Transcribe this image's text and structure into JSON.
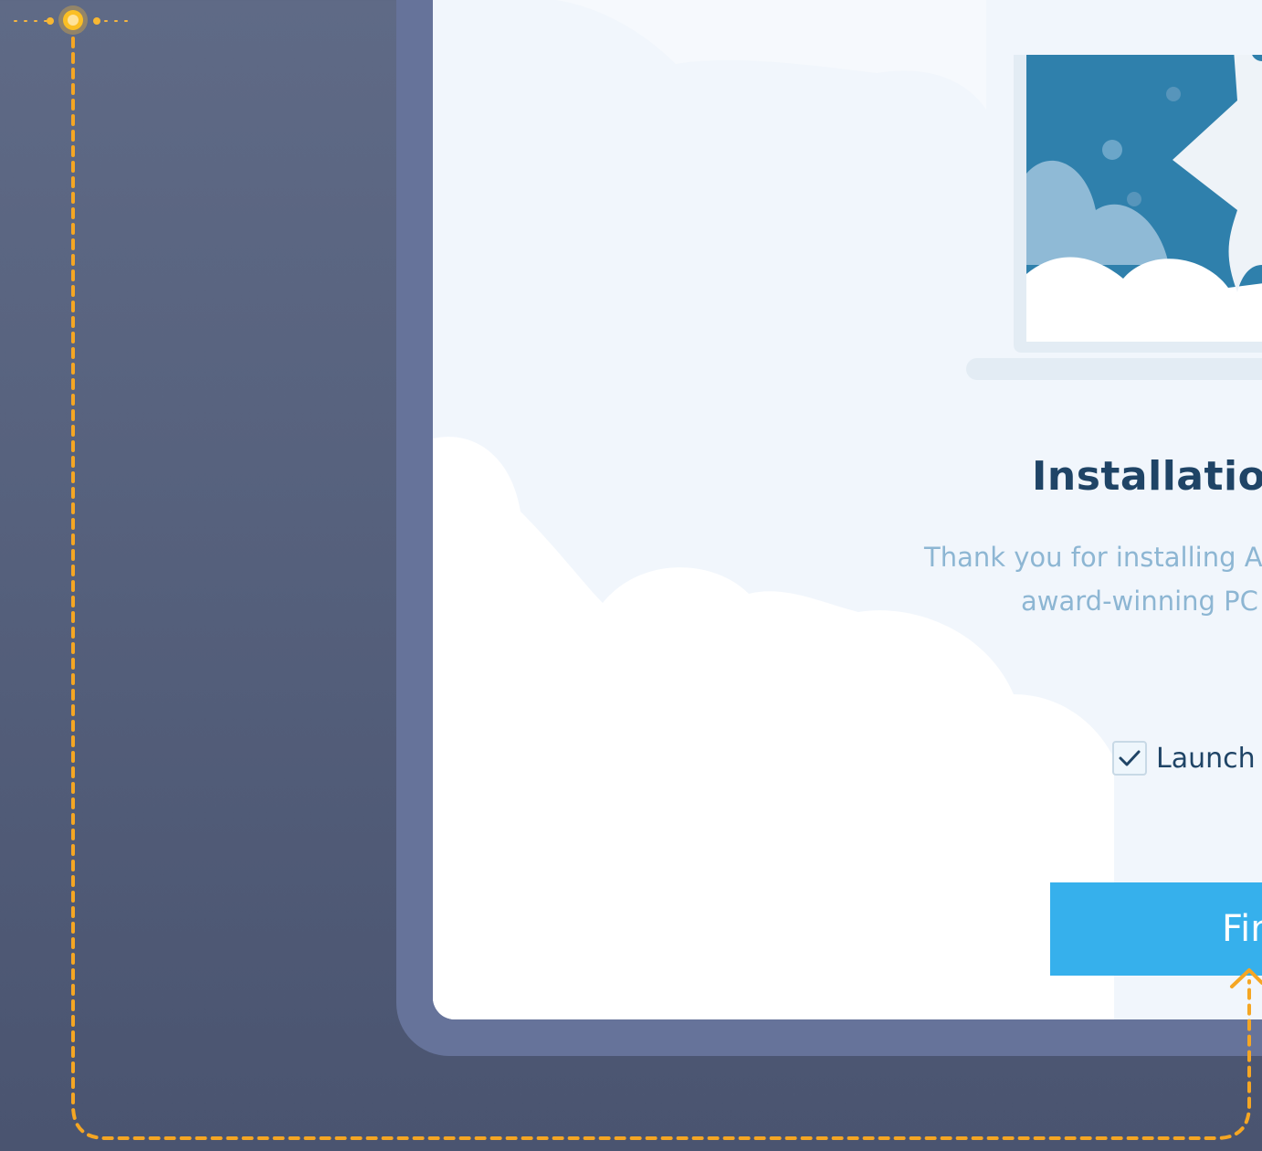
{
  "dialog": {
    "title": "Installation",
    "description_line1": "Thank you for installing A",
    "description_line2": "award-winning PC",
    "launch_checkbox": {
      "label": "Launch",
      "checked": true
    },
    "finish_button_label": "Fin"
  },
  "colors": {
    "background": "#56617d",
    "frame": "#66739a",
    "window": "#f1f6fc",
    "title": "#1f4466",
    "description": "#8db6d3",
    "accent_button": "#36b0ec",
    "annotation": "#f5a623"
  },
  "icons": [
    "check-icon",
    "rocket-laptop-illustration",
    "up-arrow-icon",
    "target-marker-icon"
  ]
}
